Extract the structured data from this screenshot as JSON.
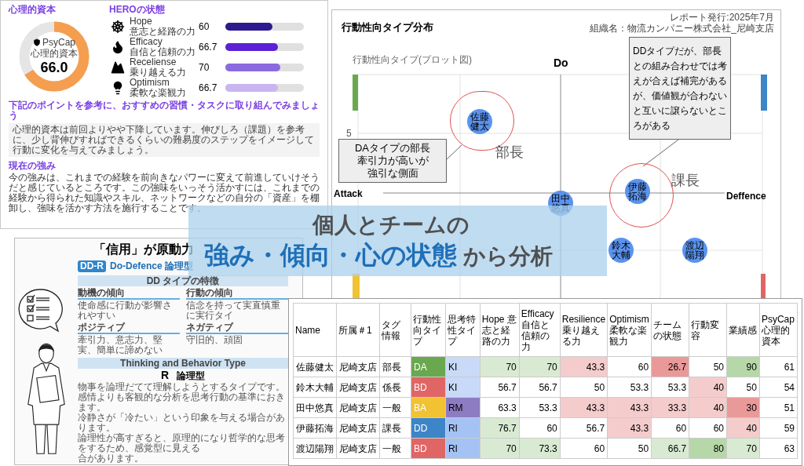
{
  "profile_panel": {
    "capital_heading": "心理的資本",
    "donut": {
      "label_en": "PsyCap",
      "label": "心理的資本",
      "value": "66.0",
      "level": 0.66
    },
    "hero_heading": "HEROの状態",
    "hero": [
      {
        "kind": "hope",
        "name": "Hope",
        "subtitle": "意志と経路の力",
        "value": "60",
        "level": 0.6,
        "color": "#2e1a8f"
      },
      {
        "kind": "efficacy",
        "name": "Efficacy",
        "subtitle": "自信と信頼の力",
        "value": "66.7",
        "level": 0.667,
        "color": "#5b21d6"
      },
      {
        "kind": "resilience",
        "name": "Receliense",
        "subtitle": "乗り越える力",
        "value": "70",
        "level": 0.7,
        "color": "#8b6ae0"
      },
      {
        "kind": "optimism",
        "name": "Optimism",
        "subtitle": "柔軟な楽観力",
        "value": "66.7",
        "level": 0.667,
        "color": "#c9b5ef"
      }
    ],
    "tip_heading": "下記のポイントを参考に、おすすめの習慣・タスクに取り組んでみましょう",
    "tip_text": "心理的資本は前回よりやや下降しています。伸びしろ（課題）を参考に、少し背伸びすればできるくらいの難易度のステップをイメージして行動に変化を与えてみましょう。",
    "strength_heading": "現在の強み",
    "strength_text": "今の強みは、これまでの経験を前向きなパワーに変えて前進していけそうだと感じているところです。この強味をいっそう活かすには、これまでの経験から得られた知識やスキル、ネットワークなどの自分の「資産」を棚卸し、強味を活かす方法を施行することです。"
  },
  "chart_panel": {
    "title": "行動性向タイプ分布",
    "report_date": "レポート発行:2025年7月",
    "organization": "組織名：物流カンパニー株式会社_尼崎支店",
    "plot_title": "行動性向タイプ(プロット図)",
    "top_label": "Do",
    "left_label": "Attack",
    "right_label": "Deffence",
    "tick": "5",
    "points": [
      {
        "name": "佐藤健太"
      },
      {
        "name": "田中悠真"
      },
      {
        "name": "伊藤拓海"
      },
      {
        "name": "鈴木大輔"
      },
      {
        "name": "渡辺陽翔"
      }
    ],
    "callouts": [
      {
        "lines": [
          "DAタイプの部長",
          "牽引力が高いが",
          "強引な側面"
        ]
      },
      {
        "lines": [
          "DDタイプだが、部長",
          "との組み合わせでは考",
          "えが合えば補完がある",
          "が、価値観が合わない",
          "と互いに譲らないとこ",
          "ろがある"
        ]
      }
    ],
    "role_labels": [
      "部長",
      "課長"
    ]
  },
  "banner": {
    "line1": "個人とチームの",
    "highlight": "強み・傾向・心の状態",
    "tail": "から分析"
  },
  "type_panel": {
    "title": "「信用」が原動力",
    "badge": "DD-R",
    "type_name": "Do-Defence 論理型",
    "features_heading": "DD タイプの特徴",
    "features": [
      {
        "label": "動機の傾向",
        "text": "使命感に行動が影響されやすい"
      },
      {
        "label": "行動の傾向",
        "text": "信念を持って実直慎重に実行タイ"
      },
      {
        "label": "ポジティブ",
        "text": "牽引力、意志力、堅実、簡単に諦めない"
      },
      {
        "label": "ネガティブ",
        "text": "守旧的、頑固"
      }
    ],
    "thinking_heading": "Thinking and Behavior Type",
    "type_letter": "R",
    "type_label": "論理型",
    "description": [
      "物事を論理だてて理解しようとするタイプです。",
      "感情よりも客観的な分析を思考行動の基準におきます。",
      "冷静さが「冷たい」という印象を与える場合があります。",
      "論理性が高すぎると、原理的になり哲学的な思考をするため、感覚型に見える",
      "合があります。"
    ]
  },
  "table": {
    "columns": [
      "Name",
      "所属＃1",
      "タグ情報",
      "行動性向タイプ",
      "思考特性タイプ",
      "Hope 意志と経路の力",
      "Efficacy 自信と信頼の力",
      "Resilience 乗り越える力",
      "Optimism 柔軟な楽観力",
      "チームの状態",
      "行動変容",
      "業績感",
      "PsyCap 心理的資本"
    ],
    "rows": [
      {
        "cells": [
          {
            "text": "佐藤健太"
          },
          {
            "text": "尼崎支店"
          },
          {
            "text": "部長"
          },
          {
            "text": "DA",
            "color": "#6aa84f"
          },
          {
            "text": "KI",
            "color": "#c9daf8"
          },
          {
            "text": "70",
            "color": "#d9ead3"
          },
          {
            "text": "70",
            "color": "#d9ead3"
          },
          {
            "text": "43.3",
            "color": "#f4cccc"
          },
          {
            "text": "60"
          },
          {
            "text": "26.7",
            "color": "#ea9999"
          },
          {
            "text": "50"
          },
          {
            "text": "90",
            "color": "#b6d7a8"
          },
          {
            "text": "61"
          }
        ]
      },
      {
        "cells": [
          {
            "text": "鈴木大輔"
          },
          {
            "text": "尼崎支店"
          },
          {
            "text": "係長"
          },
          {
            "text": "BD",
            "color": "#e06666"
          },
          {
            "text": "KI",
            "color": "#c9daf8"
          },
          {
            "text": "56.7"
          },
          {
            "text": "56.7"
          },
          {
            "text": "50"
          },
          {
            "text": "53.3"
          },
          {
            "text": "53.3"
          },
          {
            "text": "40",
            "color": "#f4cccc"
          },
          {
            "text": "50"
          },
          {
            "text": "54"
          }
        ]
      },
      {
        "cells": [
          {
            "text": "田中悠真"
          },
          {
            "text": "尼崎支店"
          },
          {
            "text": "一般"
          },
          {
            "text": "BA",
            "color": "#f1c232"
          },
          {
            "text": "RM",
            "color": "#8e7cc3"
          },
          {
            "text": "63.3"
          },
          {
            "text": "53.3"
          },
          {
            "text": "43.3",
            "color": "#f4cccc"
          },
          {
            "text": "43.3",
            "color": "#f4cccc"
          },
          {
            "text": "33.3",
            "color": "#f4cccc"
          },
          {
            "text": "40",
            "color": "#f4cccc"
          },
          {
            "text": "30",
            "color": "#ea9999"
          },
          {
            "text": "51"
          }
        ]
      },
      {
        "cells": [
          {
            "text": "伊藤拓海"
          },
          {
            "text": "尼崎支店"
          },
          {
            "text": "課長"
          },
          {
            "text": "DD",
            "color": "#3d85c6"
          },
          {
            "text": "RI",
            "color": "#a4c2f4"
          },
          {
            "text": "76.7",
            "color": "#d9ead3"
          },
          {
            "text": "60"
          },
          {
            "text": "56.7"
          },
          {
            "text": "43.3",
            "color": "#f4cccc"
          },
          {
            "text": "60"
          },
          {
            "text": "60"
          },
          {
            "text": "40",
            "color": "#f4cccc"
          },
          {
            "text": "59"
          }
        ]
      },
      {
        "cells": [
          {
            "text": "渡辺陽翔"
          },
          {
            "text": "尼崎支店"
          },
          {
            "text": "一般"
          },
          {
            "text": "BD",
            "color": "#e06666"
          },
          {
            "text": "RI",
            "color": "#a4c2f4"
          },
          {
            "text": "70",
            "color": "#d9ead3"
          },
          {
            "text": "73.3",
            "color": "#d9ead3"
          },
          {
            "text": "60"
          },
          {
            "text": "50"
          },
          {
            "text": "66.7",
            "color": "#d9ead3"
          },
          {
            "text": "80",
            "color": "#b6d7a8"
          },
          {
            "text": "70",
            "color": "#d9ead3"
          },
          {
            "text": "63"
          }
        ]
      }
    ]
  }
}
